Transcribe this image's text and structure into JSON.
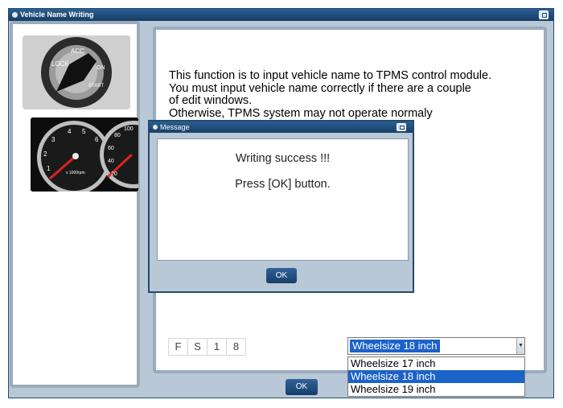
{
  "window": {
    "title": "Vehicle Name Writing"
  },
  "info": {
    "lines": [
      "This function is to input vehicle name to TPMS control module.",
      "You must input vehicle name correctly if there are a couple",
      "of edit windows.",
      "Otherwise, TPMS system may not operate normaly"
    ]
  },
  "vehicle_code": [
    "F",
    "S",
    "1",
    "8"
  ],
  "wheel_select": {
    "selected": "Wheelsize 18 inch",
    "options": [
      "Wheelsize 17 inch",
      "Wheelsize 18 inch",
      "Wheelsize 19 inch"
    ]
  },
  "main_ok_label": "OK",
  "message_dialog": {
    "title": "Message",
    "line1": "Writing success !!!",
    "line2": "Press [OK] button.",
    "ok_label": "OK"
  },
  "gauge": {
    "left_ticks": [
      "1",
      "2",
      "3",
      "4",
      "5",
      "6"
    ],
    "right_ticks": [
      "20",
      "40",
      "60",
      "80",
      "100"
    ],
    "unit": "x 1000rpm"
  },
  "ignition_labels": [
    "LOCK",
    "ACC",
    "START",
    "ON"
  ]
}
